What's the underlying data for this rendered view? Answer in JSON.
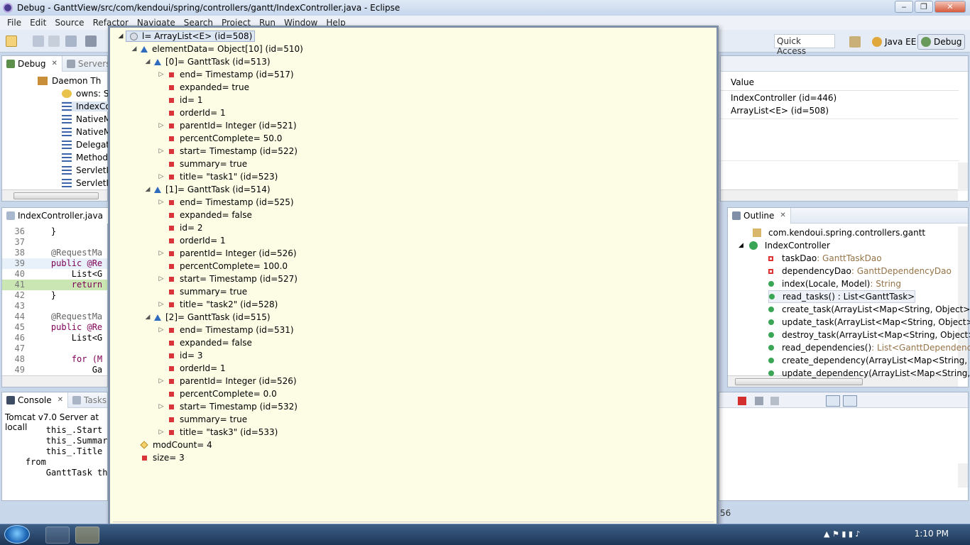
{
  "window": {
    "title": "Debug - GanttView/src/com/kendoui/spring/controllers/gantt/IndexController.java - Eclipse"
  },
  "menu": [
    "File",
    "Edit",
    "Source",
    "Refactor",
    "Navigate",
    "Search",
    "Project",
    "Run",
    "Window",
    "Help"
  ],
  "toolbar": {
    "quick_access": "Quick Access"
  },
  "perspectives": {
    "java_ee": "Java EE",
    "debug": "Debug"
  },
  "debug_view": {
    "tabs": [
      "Debug",
      "Servers"
    ],
    "items": [
      "Daemon Th",
      "owns: So",
      "IndexCo",
      "NativeM",
      "NativeM",
      "Delegati",
      "Method",
      "ServletIn",
      "ServletIn"
    ]
  },
  "variables_view": {
    "column_value": "Value",
    "rows": [
      "IndexController  (id=446)",
      "ArrayList<E>  (id=508)"
    ]
  },
  "editor": {
    "tab": "IndexController.java",
    "lines": [
      {
        "n": "36",
        "code": "    }"
      },
      {
        "n": "37",
        "code": ""
      },
      {
        "n": "38",
        "code": "    @RequestMa"
      },
      {
        "n": "39",
        "code": "    public @Re"
      },
      {
        "n": "40",
        "code": "        List<G"
      },
      {
        "n": "41",
        "code": "        return"
      },
      {
        "n": "42",
        "code": "    }"
      },
      {
        "n": "43",
        "code": ""
      },
      {
        "n": "44",
        "code": "    @RequestMa"
      },
      {
        "n": "45",
        "code": "    public @Re"
      },
      {
        "n": "46",
        "code": "        List<G"
      },
      {
        "n": "47",
        "code": ""
      },
      {
        "n": "48",
        "code": "        for (M"
      },
      {
        "n": "49",
        "code": "            Ga"
      }
    ]
  },
  "outline": {
    "tab": "Outline",
    "package": "com.kendoui.spring.controllers.gantt",
    "class": "IndexController",
    "members": [
      {
        "name": "taskDao",
        "type": " : GanttTaskDao",
        "kind": "field"
      },
      {
        "name": "dependencyDao",
        "type": " : GanttDependencyDao",
        "kind": "field"
      },
      {
        "name": "index(Locale, Model)",
        "type": " : String",
        "kind": "method"
      },
      {
        "name": "read_tasks() : List<GanttTask>",
        "type": "",
        "kind": "method"
      },
      {
        "name": "create_task(ArrayList<Map<String, Object>>",
        "type": "",
        "kind": "method"
      },
      {
        "name": "update_task(ArrayList<Map<String, Object>:",
        "type": "",
        "kind": "method"
      },
      {
        "name": "destroy_task(ArrayList<Map<String, Object>",
        "type": "",
        "kind": "method"
      },
      {
        "name": "read_dependencies()",
        "type": " : List<GanttDependency",
        "kind": "method"
      },
      {
        "name": "create_dependency(ArrayList<Map<String, C",
        "type": "",
        "kind": "method"
      },
      {
        "name": "update_dependency(ArrayList<Map<String, (",
        "type": "",
        "kind": "method"
      }
    ]
  },
  "console": {
    "tabs": [
      "Console",
      "Tasks"
    ],
    "header": "Tomcat v7.0 Server at locall",
    "lines": [
      "        this_.Start a",
      "        this_.Summary",
      "        this_.Title a",
      "    from",
      "        GanttTask thi"
    ]
  },
  "status": {
    "fragment": "56"
  },
  "inspect_popup": {
    "root": "l= ArrayList<E>  (id=508)",
    "rows": [
      {
        "indent": 1,
        "tw": "open",
        "icon": "tri",
        "text": "elementData= Object[10]  (id=510)"
      },
      {
        "indent": 2,
        "tw": "open",
        "icon": "tri",
        "text": "[0]= GanttTask  (id=513)"
      },
      {
        "indent": 3,
        "tw": "closed",
        "icon": "sq",
        "text": "end= Timestamp  (id=517)"
      },
      {
        "indent": 3,
        "tw": "",
        "icon": "sq",
        "text": "expanded= true"
      },
      {
        "indent": 3,
        "tw": "",
        "icon": "sq",
        "text": "id= 1"
      },
      {
        "indent": 3,
        "tw": "",
        "icon": "sq",
        "text": "orderId= 1"
      },
      {
        "indent": 3,
        "tw": "closed",
        "icon": "sq",
        "text": "parentId= Integer  (id=521)"
      },
      {
        "indent": 3,
        "tw": "",
        "icon": "sq",
        "text": "percentComplete= 50.0"
      },
      {
        "indent": 3,
        "tw": "closed",
        "icon": "sq",
        "text": "start= Timestamp  (id=522)"
      },
      {
        "indent": 3,
        "tw": "",
        "icon": "sq",
        "text": "summary= true"
      },
      {
        "indent": 3,
        "tw": "closed",
        "icon": "sq",
        "text": "title= \"task1\"  (id=523)"
      },
      {
        "indent": 2,
        "tw": "open",
        "icon": "tri",
        "text": "[1]= GanttTask  (id=514)"
      },
      {
        "indent": 3,
        "tw": "closed",
        "icon": "sq",
        "text": "end= Timestamp  (id=525)"
      },
      {
        "indent": 3,
        "tw": "",
        "icon": "sq",
        "text": "expanded= false"
      },
      {
        "indent": 3,
        "tw": "",
        "icon": "sq",
        "text": "id= 2"
      },
      {
        "indent": 3,
        "tw": "",
        "icon": "sq",
        "text": "orderId= 1"
      },
      {
        "indent": 3,
        "tw": "closed",
        "icon": "sq",
        "text": "parentId= Integer  (id=526)"
      },
      {
        "indent": 3,
        "tw": "",
        "icon": "sq",
        "text": "percentComplete= 100.0"
      },
      {
        "indent": 3,
        "tw": "closed",
        "icon": "sq",
        "text": "start= Timestamp  (id=527)"
      },
      {
        "indent": 3,
        "tw": "",
        "icon": "sq",
        "text": "summary= true"
      },
      {
        "indent": 3,
        "tw": "closed",
        "icon": "sq",
        "text": "title= \"task2\"  (id=528)"
      },
      {
        "indent": 2,
        "tw": "open",
        "icon": "tri",
        "text": "[2]= GanttTask  (id=515)"
      },
      {
        "indent": 3,
        "tw": "closed",
        "icon": "sq",
        "text": "end= Timestamp  (id=531)"
      },
      {
        "indent": 3,
        "tw": "",
        "icon": "sq",
        "text": "expanded= false"
      },
      {
        "indent": 3,
        "tw": "",
        "icon": "sq",
        "text": "id= 3"
      },
      {
        "indent": 3,
        "tw": "",
        "icon": "sq",
        "text": "orderId= 1"
      },
      {
        "indent": 3,
        "tw": "closed",
        "icon": "sq",
        "text": "parentId= Integer  (id=526)"
      },
      {
        "indent": 3,
        "tw": "",
        "icon": "sq",
        "text": "percentComplete= 0.0"
      },
      {
        "indent": 3,
        "tw": "closed",
        "icon": "sq",
        "text": "start= Timestamp  (id=532)"
      },
      {
        "indent": 3,
        "tw": "",
        "icon": "sq",
        "text": "summary= true"
      },
      {
        "indent": 3,
        "tw": "closed",
        "icon": "sq",
        "text": "title= \"task3\"  (id=533)"
      },
      {
        "indent": 1,
        "tw": "",
        "icon": "dia",
        "text": "modCount= 4"
      },
      {
        "indent": 1,
        "tw": "",
        "icon": "sq",
        "text": "size= 3"
      }
    ]
  },
  "taskbar": {
    "clock": "1:10 PM"
  }
}
